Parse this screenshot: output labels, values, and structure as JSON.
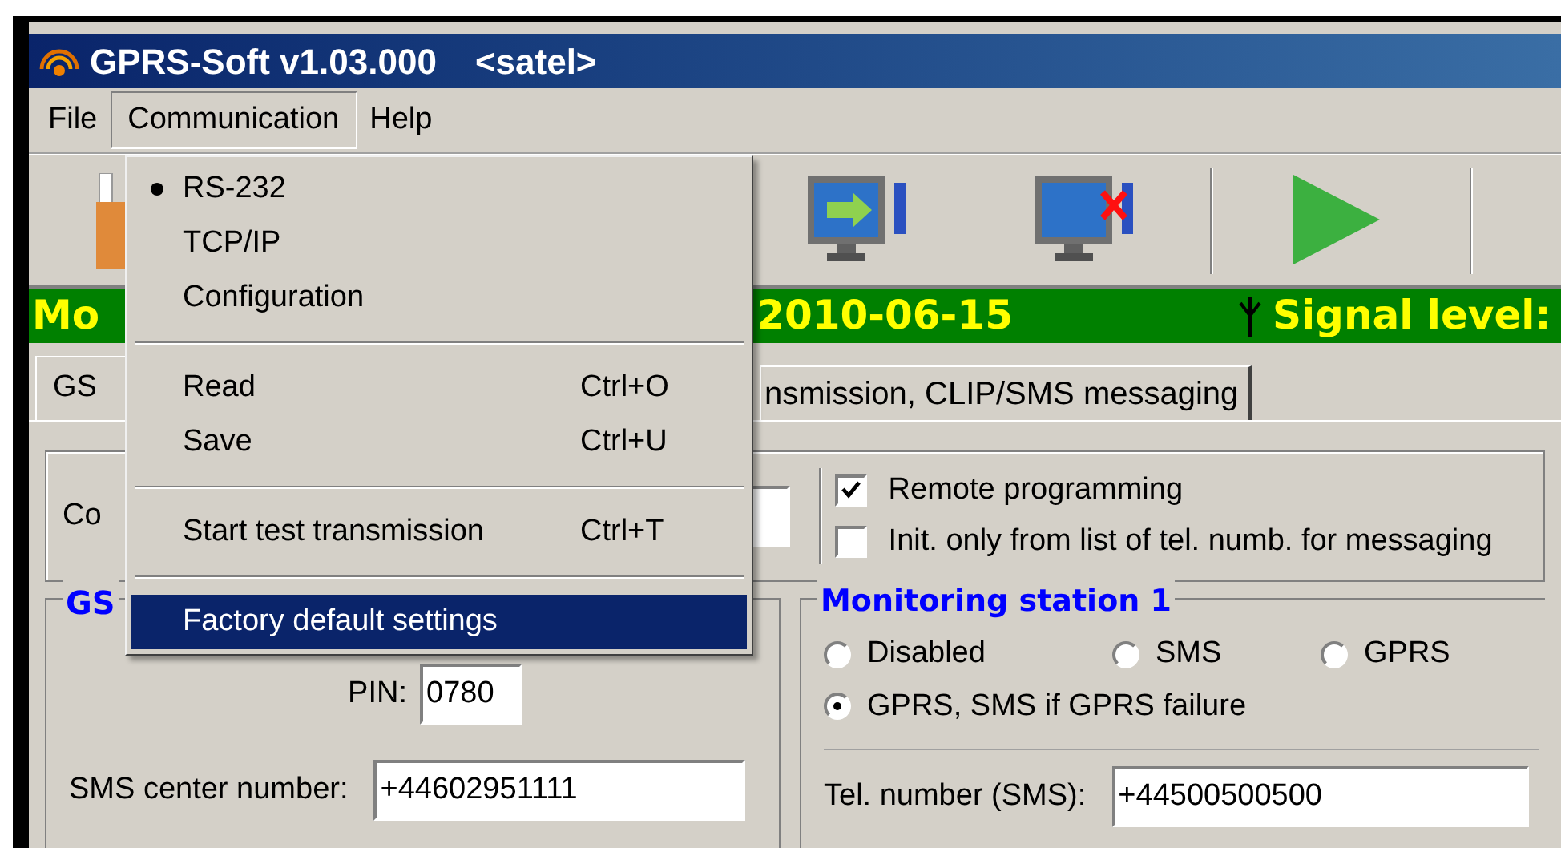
{
  "window": {
    "title": "GPRS-Soft v1.03.000",
    "subtitle": "<satel>"
  },
  "menu_bar": [
    {
      "label": "File",
      "selected": false
    },
    {
      "label": "Communication",
      "selected": true
    },
    {
      "label": "Help",
      "selected": false
    }
  ],
  "open_menu": {
    "items": [
      {
        "kind": "radio",
        "label": "RS-232",
        "checked": true
      },
      {
        "kind": "radio",
        "label": "TCP/IP",
        "checked": false
      },
      {
        "kind": "item",
        "label": "Configuration",
        "selected": false
      },
      {
        "kind": "separator"
      },
      {
        "kind": "item",
        "label": "Read",
        "shortcut": "Ctrl+O",
        "selected": false
      },
      {
        "kind": "item",
        "label": "Save",
        "shortcut": "Ctrl+U",
        "selected": false
      },
      {
        "kind": "separator"
      },
      {
        "kind": "item",
        "label": "Start test transmission",
        "shortcut": "Ctrl+T",
        "selected": false
      },
      {
        "kind": "separator"
      },
      {
        "kind": "item",
        "label": "Factory default settings",
        "selected": true
      }
    ]
  },
  "status_bar": {
    "module": "Mo",
    "date": "2010-06-15",
    "signal_label": "Signal level:"
  },
  "tabs": [
    {
      "label": "GS",
      "selected": true
    },
    {
      "label": "nsmission, CLIP/SMS messaging",
      "selected": false
    }
  ],
  "connection_group": {
    "label": "Co",
    "options": [
      {
        "label": "Remote programming",
        "checked": true
      },
      {
        "label": "Init. only from list of tel. numb. for messaging",
        "checked": false
      }
    ]
  },
  "gsm_group": {
    "title": "GS",
    "pin_label": "PIN:",
    "pin": "0780",
    "sms_center_label": "SMS center number:",
    "sms_center": "+44602951111"
  },
  "monitoring_station": {
    "title": "Monitoring station 1",
    "modes": [
      {
        "label": "Disabled",
        "selected": false
      },
      {
        "label": "SMS",
        "selected": false
      },
      {
        "label": "GPRS",
        "selected": false
      },
      {
        "label": "GPRS, SMS if GPRS failure",
        "selected": true
      }
    ],
    "tel_label": "Tel. number (SMS):",
    "tel_value": "+44500500500"
  }
}
